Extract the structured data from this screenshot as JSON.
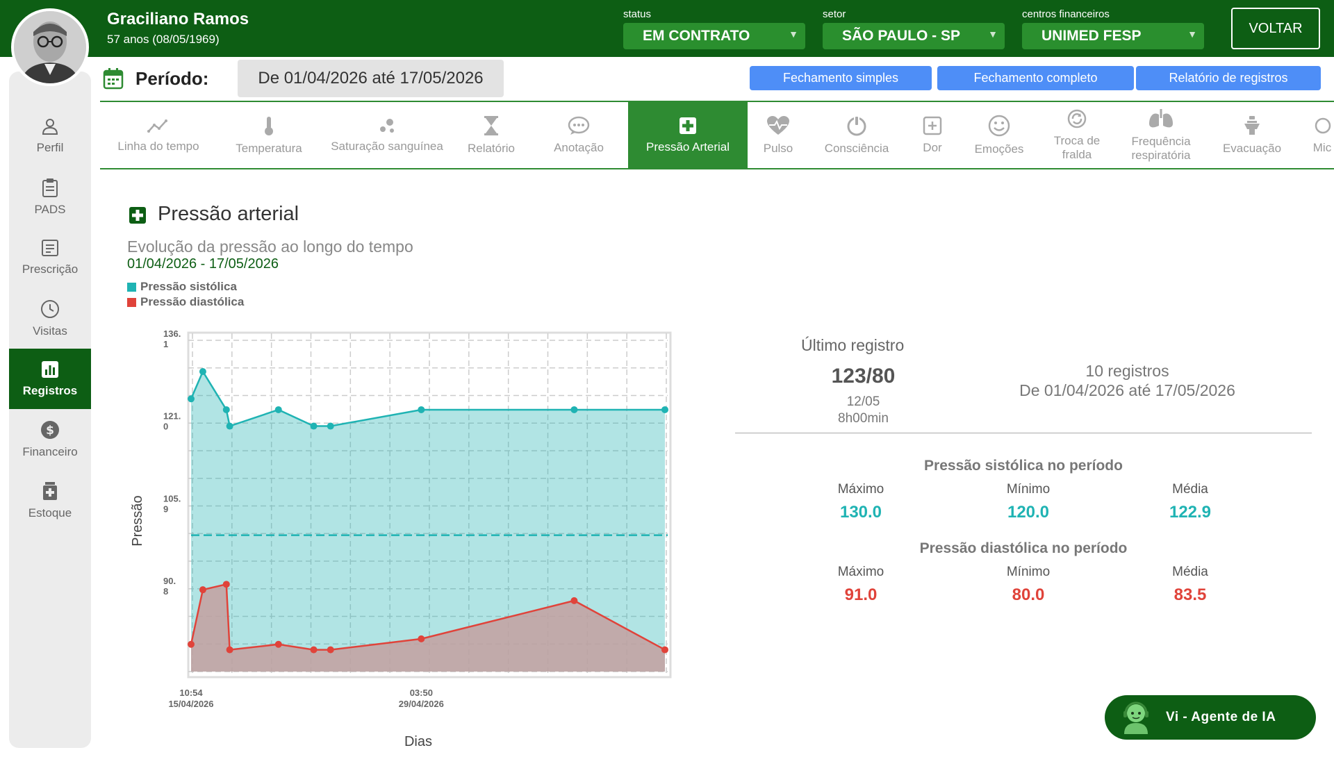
{
  "header": {
    "patient_name": "Graciliano Ramos",
    "patient_age": "57 anos (08/05/1969)",
    "status_label": "status",
    "status_value": "EM CONTRATO",
    "setor_label": "setor",
    "setor_value": "SÃO PAULO - SP",
    "centros_label": "centros financeiros",
    "centros_value": "UNIMED FESP",
    "back_label": "VOLTAR",
    "brand_color": "#0d5e14"
  },
  "sidebar": {
    "items": [
      {
        "label": "Perfil",
        "icon": "person-icon"
      },
      {
        "label": "PADS",
        "icon": "clipboard-icon"
      },
      {
        "label": "Prescrição",
        "icon": "document-icon"
      },
      {
        "label": "Visitas",
        "icon": "clock-icon"
      },
      {
        "label": "Registros",
        "icon": "bar-chart-icon",
        "active": true
      },
      {
        "label": "Financeiro",
        "icon": "dollar-icon"
      },
      {
        "label": "Estoque",
        "icon": "medicine-box-icon"
      }
    ]
  },
  "period": {
    "label": "Período:",
    "value": "De 01/04/2026 até 17/05/2026"
  },
  "actions": {
    "simple": "Fechamento simples",
    "complete": "Fechamento completo",
    "report": "Relatório de registros"
  },
  "tabs": [
    {
      "label": "Linha do tempo",
      "icon": "timeline-icon"
    },
    {
      "label": "Temperatura",
      "icon": "thermometer-icon"
    },
    {
      "label": "Saturação sanguínea",
      "icon": "drops-icon"
    },
    {
      "label": "Relatório",
      "icon": "hourglass-icon"
    },
    {
      "label": "Anotação",
      "icon": "chat-bubble-icon"
    },
    {
      "label": "Pressão Arterial",
      "icon": "plus-square-icon",
      "active": true
    },
    {
      "label": "Pulso",
      "icon": "heart-pulse-icon"
    },
    {
      "label": "Consciência",
      "icon": "power-icon"
    },
    {
      "label": "Dor",
      "icon": "plus-box-icon"
    },
    {
      "label": "Emoções",
      "icon": "smile-icon"
    },
    {
      "label_line1": "Troca de",
      "label_line2": "fralda",
      "icon": "refresh-icon"
    },
    {
      "label_line1": "Frequência",
      "label_line2": "respiratória",
      "icon": "lungs-icon"
    },
    {
      "label": "Evacuação",
      "icon": "toilet-icon"
    },
    {
      "label": "Mic",
      "icon": "partial-icon"
    }
  ],
  "section": {
    "title": "Pressão arterial",
    "subtitle": "Evolução da pressão ao longo do tempo",
    "range": "01/04/2026 - 17/05/2026",
    "legend_systolic": "Pressão sistólica",
    "legend_diastolic": "Pressão diastólica"
  },
  "chart_data": {
    "type": "area",
    "ylabel": "Pressão",
    "xlabel": "Dias",
    "ylim": [
      75.0,
      137.0
    ],
    "yticks": [
      {
        "line1": "136.",
        "line2": "1",
        "value": 136.1
      },
      {
        "line1": "121.",
        "line2": "0",
        "value": 121.0
      },
      {
        "line1": "105.",
        "line2": "9",
        "value": 105.9
      },
      {
        "line1": "90.",
        "line2": "8",
        "value": 90.8
      }
    ],
    "xticks": [
      {
        "line1": "10:54",
        "line2": "15/04/2026",
        "x": 0.0
      },
      {
        "line1": "03:50",
        "line2": "29/04/2026",
        "x": 13.7
      }
    ],
    "xlim": [
      0.0,
      28.2
    ],
    "reference_line": 100.0,
    "grid": true,
    "colors": {
      "systolic": "#1fb3b3",
      "diastolic": "#e0433a"
    },
    "series": [
      {
        "name": "Pressão sistólica",
        "x": [
          0.0,
          0.7,
          2.1,
          2.3,
          5.2,
          7.3,
          8.3,
          13.7,
          22.8,
          28.2
        ],
        "values": [
          125.0,
          130.0,
          123.0,
          120.0,
          123.0,
          120.0,
          120.0,
          123.0,
          123.0,
          123.0
        ]
      },
      {
        "name": "Pressão diastólica",
        "x": [
          0.0,
          0.7,
          2.1,
          2.3,
          5.2,
          7.3,
          8.3,
          13.7,
          22.8,
          28.2
        ],
        "values": [
          80.0,
          90.0,
          91.0,
          79.0,
          80.0,
          79.0,
          79.0,
          81.0,
          88.0,
          79.0
        ]
      }
    ]
  },
  "last_record": {
    "title": "Último registro",
    "value": "123/80",
    "date": "12/05",
    "time": "8h00min",
    "count": "10 registros",
    "range": "De 01/04/2026 até 17/05/2026"
  },
  "stats": {
    "systolic_heading": "Pressão sistólica no período",
    "diastolic_heading": "Pressão diastólica no período",
    "max_label": "Máximo",
    "min_label": "Mínimo",
    "avg_label": "Média",
    "systolic": {
      "max": "130.0",
      "min": "120.0",
      "avg": "122.9"
    },
    "diastolic": {
      "max": "91.0",
      "min": "80.0",
      "avg": "83.5"
    }
  },
  "ai_agent": {
    "label": "Vi - Agente de IA"
  }
}
